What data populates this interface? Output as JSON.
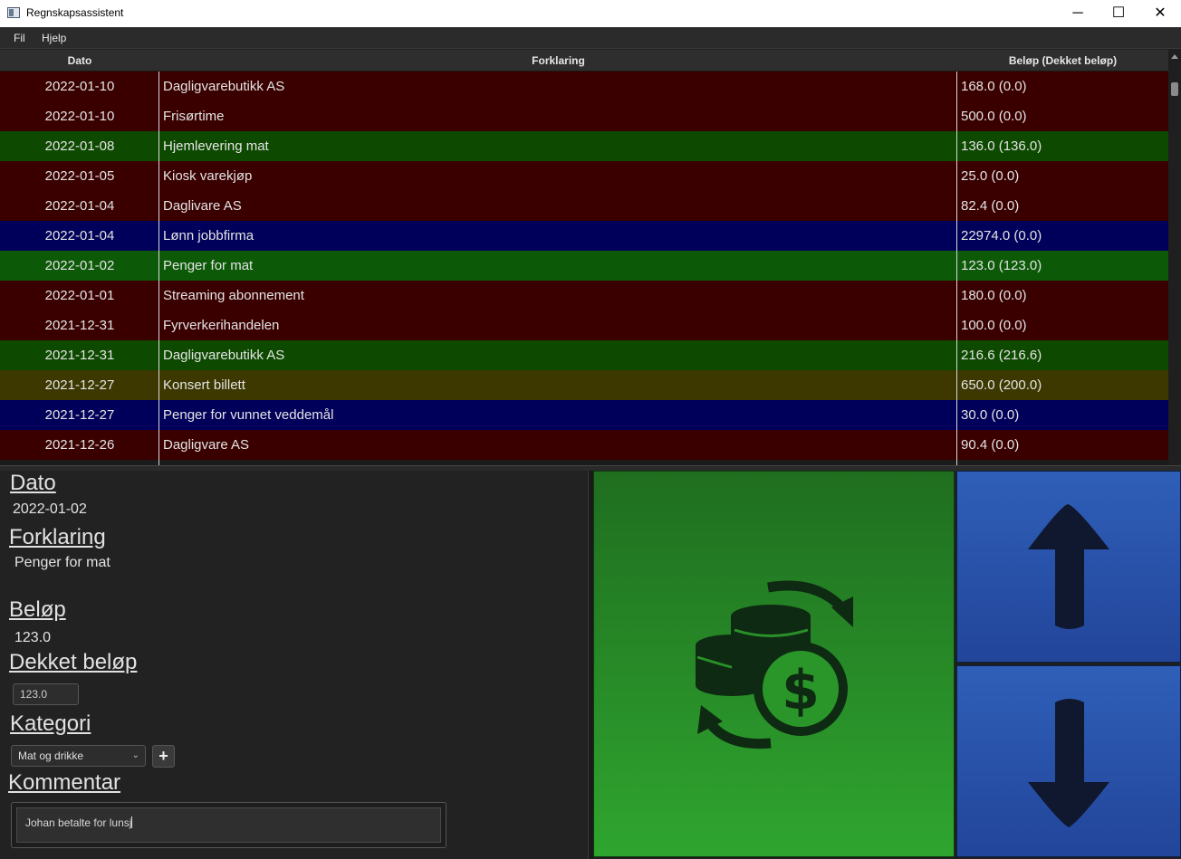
{
  "window": {
    "title": "Regnskapsassistent",
    "minimize_icon": "─",
    "maximize_icon": "☐",
    "close_icon": "✕"
  },
  "menu": {
    "file": "Fil",
    "help": "Hjelp"
  },
  "table": {
    "columns": [
      "Dato",
      "Forklaring",
      "Beløp (Dekket beløp)"
    ],
    "rows": [
      {
        "date": "2022-01-10",
        "description": "Dagligvarebutikk AS",
        "amount": "168.0 (0.0)",
        "color": "red"
      },
      {
        "date": "2022-01-10",
        "description": "Frisørtime",
        "amount": "500.0 (0.0)",
        "color": "red"
      },
      {
        "date": "2022-01-08",
        "description": "Hjemlevering mat",
        "amount": "136.0 (136.0)",
        "color": "green"
      },
      {
        "date": "2022-01-05",
        "description": "Kiosk varekjøp",
        "amount": "25.0 (0.0)",
        "color": "red"
      },
      {
        "date": "2022-01-04",
        "description": "Daglivare AS",
        "amount": "82.4 (0.0)",
        "color": "red"
      },
      {
        "date": "2022-01-04",
        "description": "Lønn jobbfirma",
        "amount": "22974.0 (0.0)",
        "color": "blue"
      },
      {
        "date": "2022-01-02",
        "description": "Penger for mat",
        "amount": "123.0 (123.0)",
        "color": "sel"
      },
      {
        "date": "2022-01-01",
        "description": "Streaming abonnement",
        "amount": "180.0 (0.0)",
        "color": "red"
      },
      {
        "date": "2021-12-31",
        "description": "Fyrverkerihandelen",
        "amount": "100.0 (0.0)",
        "color": "red"
      },
      {
        "date": "2021-12-31",
        "description": "Dagligvarebutikk AS",
        "amount": "216.6 (216.6)",
        "color": "green"
      },
      {
        "date": "2021-12-27",
        "description": "Konsert billett",
        "amount": "650.0 (200.0)",
        "color": "olive"
      },
      {
        "date": "2021-12-27",
        "description": "Penger for vunnet veddemål",
        "amount": "30.0 (0.0)",
        "color": "blue"
      },
      {
        "date": "2021-12-26",
        "description": "Dagligvare AS",
        "amount": "90.4 (0.0)",
        "color": "red"
      }
    ]
  },
  "detail": {
    "date_label": "Dato",
    "date_value": "2022-01-02",
    "description_label": "Forklaring",
    "description_value": "Penger for mat",
    "amount_label": "Beløp",
    "amount_value": "123.0",
    "covered_label": "Dekket beløp",
    "covered_value": "123.0",
    "category_label": "Kategori",
    "category_value": "Mat og drikke",
    "add_category_icon": "+",
    "comment_label": "Kommentar",
    "comment_value": "Johan betalte for lunsj"
  },
  "buttons": {
    "coverage_icon": "coins-exchange-icon",
    "up_icon": "arrow-up-icon",
    "down_icon": "arrow-down-icon"
  },
  "colors": {
    "row_red": "#3a0000",
    "row_green": "#0d4a00",
    "row_blue": "#00005a",
    "row_olive": "#3c3800",
    "button_green": "#2fa52f",
    "button_blue": "#2f5fb8"
  }
}
